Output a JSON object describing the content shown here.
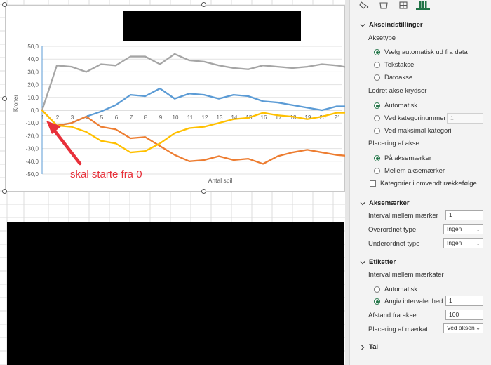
{
  "chart_data": {
    "type": "line",
    "title": "",
    "xlabel": "Antal spil",
    "ylabel": "Kroner",
    "ylim": [
      -50,
      50
    ],
    "y_ticks": [
      "50,0",
      "40,0",
      "30,0",
      "20,0",
      "10,0",
      "0,0",
      "-10,0",
      "-20,0",
      "-30,0",
      "-40,0",
      "-50,0"
    ],
    "x": [
      0,
      1,
      2,
      3,
      4,
      5,
      6,
      7,
      8,
      9,
      10,
      11,
      12,
      13,
      14,
      15,
      16,
      17,
      18,
      19,
      20,
      21
    ],
    "x_tick_labels": [
      "1",
      "2",
      "3",
      "4",
      "5",
      "6",
      "7",
      "8",
      "9",
      "10",
      "11",
      "12",
      "13",
      "14",
      "15",
      "16",
      "17",
      "18",
      "19",
      "20",
      "21"
    ],
    "series": [
      {
        "color": "#a5a5a5",
        "values": [
          0,
          35,
          34,
          30,
          36,
          35,
          42,
          42,
          36,
          44,
          39,
          38,
          35,
          33,
          32,
          35,
          34,
          33,
          34,
          36,
          35,
          33
        ]
      },
      {
        "color": "#5b9bd5",
        "values": [
          0,
          -12,
          -10,
          -5,
          -1,
          4,
          12,
          11,
          17,
          9,
          13,
          12,
          9,
          12,
          11,
          7,
          6,
          4,
          2,
          0,
          3,
          3
        ]
      },
      {
        "color": "#ed7d31",
        "values": [
          0,
          -12,
          -10,
          -5,
          -13,
          -15,
          -22,
          -21,
          -28,
          -35,
          -40,
          -39,
          -36,
          -39,
          -38,
          -42,
          -36,
          -33,
          -31,
          -33,
          -35,
          -36
        ]
      },
      {
        "color": "#ffc000",
        "values": [
          0,
          -12,
          -13,
          -17,
          -24,
          -26,
          -33,
          -32,
          -26,
          -18,
          -14,
          -13,
          -10,
          -7,
          -6,
          -2,
          -4,
          -5,
          -7,
          -5,
          -2,
          -2
        ]
      }
    ]
  },
  "annotation": {
    "text": "skal starte fra 0",
    "color": "#e8303a"
  },
  "pane": {
    "tab_icons": [
      "paint-bucket-icon",
      "pentagon-icon",
      "size-properties-icon",
      "bar-chart-icon"
    ],
    "axis_options": {
      "title": "Akseindstillinger",
      "axis_type_label": "Aksetype",
      "axis_type_options": [
        {
          "label": "Vælg automatisk ud fra data",
          "selected": true
        },
        {
          "label": "Tekstakse",
          "selected": false
        },
        {
          "label": "Datoakse",
          "selected": false
        }
      ],
      "vertical_crosses_label": "Lodret akse krydser",
      "vertical_crosses_options": [
        {
          "label": "Automatisk",
          "selected": true
        },
        {
          "label": "Ved kategorinummer",
          "selected": false
        },
        {
          "label": "Ved maksimal kategori",
          "selected": false
        }
      ],
      "category_number_value": "1",
      "axis_position_label": "Placering af akse",
      "axis_position_options": [
        {
          "label": "På aksemærker",
          "selected": true
        },
        {
          "label": "Mellem aksemærker",
          "selected": false
        }
      ],
      "reverse_order_label": "Kategorier i omvendt rækkefølge"
    },
    "tick_marks": {
      "title": "Aksemærker",
      "interval_label": "Interval mellem mærker",
      "interval_value": "1",
      "major_label": "Overordnet type",
      "major_value": "Ingen",
      "minor_label": "Underordnet type",
      "minor_value": "Ingen"
    },
    "labels": {
      "title": "Etiketter",
      "interval_label": "Interval mellem mærkater",
      "auto_label": "Automatisk",
      "specify_label": "Angiv intervalenhed",
      "specify_value": "1",
      "distance_label": "Afstand fra akse",
      "distance_value": "100",
      "position_label": "Placering af mærkat",
      "position_value": "Ved aksen"
    },
    "number": {
      "title": "Tal"
    }
  }
}
